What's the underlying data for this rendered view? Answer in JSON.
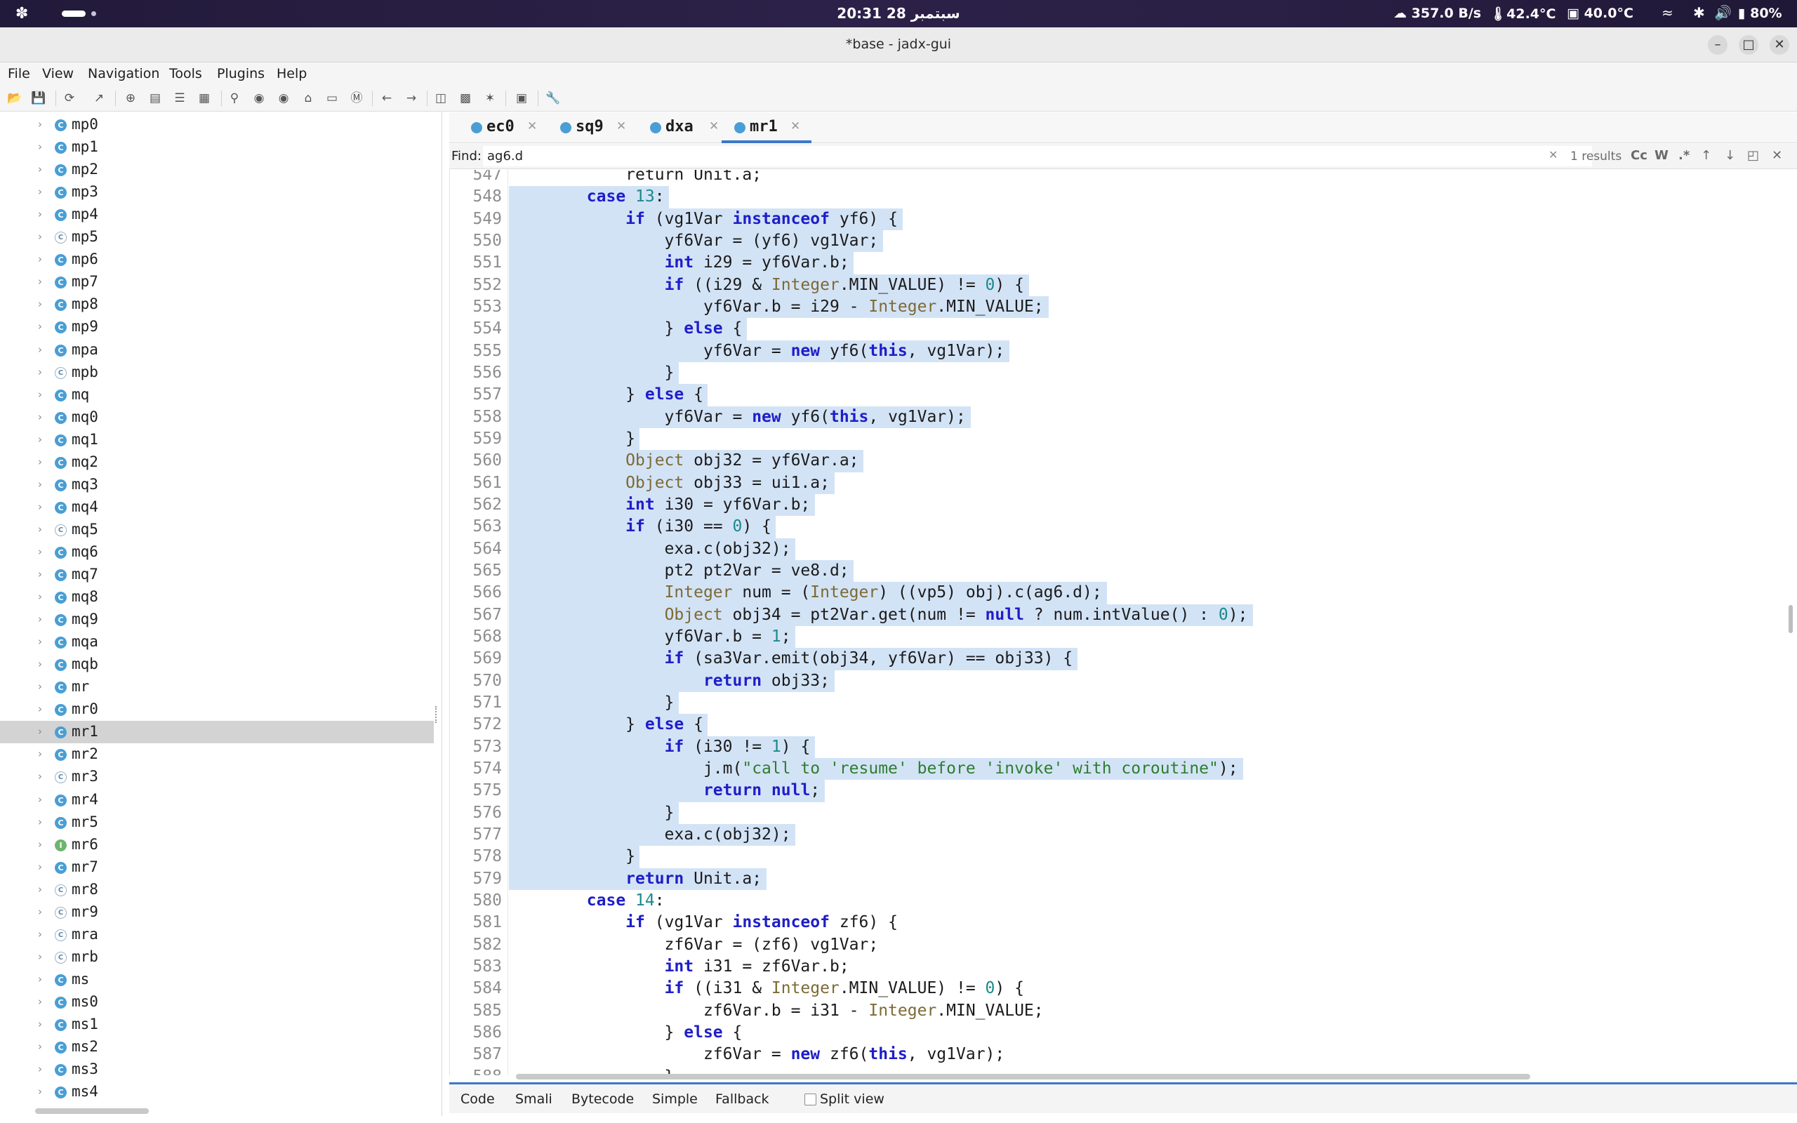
{
  "system_bar": {
    "clock": "20:31  28 سبتمبر",
    "net_speed": "357.0 B/s",
    "cpu_temp": "42.4°C",
    "gpu_temp": "40.0°C",
    "battery": "80%"
  },
  "window": {
    "title": "*base - jadx-gui"
  },
  "menu": [
    "File",
    "View",
    "Navigation",
    "Tools",
    "Plugins",
    "Help"
  ],
  "sidebar": {
    "items": [
      {
        "label": "mp0",
        "icon": "class"
      },
      {
        "label": "mp1",
        "icon": "class"
      },
      {
        "label": "mp2",
        "icon": "class"
      },
      {
        "label": "mp3",
        "icon": "class"
      },
      {
        "label": "mp4",
        "icon": "class"
      },
      {
        "label": "mp5",
        "icon": "plain"
      },
      {
        "label": "mp6",
        "icon": "class"
      },
      {
        "label": "mp7",
        "icon": "class"
      },
      {
        "label": "mp8",
        "icon": "class"
      },
      {
        "label": "mp9",
        "icon": "class"
      },
      {
        "label": "mpa",
        "icon": "class"
      },
      {
        "label": "mpb",
        "icon": "plain"
      },
      {
        "label": "mq",
        "icon": "class"
      },
      {
        "label": "mq0",
        "icon": "class"
      },
      {
        "label": "mq1",
        "icon": "class"
      },
      {
        "label": "mq2",
        "icon": "class"
      },
      {
        "label": "mq3",
        "icon": "class"
      },
      {
        "label": "mq4",
        "icon": "class"
      },
      {
        "label": "mq5",
        "icon": "plain"
      },
      {
        "label": "mq6",
        "icon": "class"
      },
      {
        "label": "mq7",
        "icon": "class"
      },
      {
        "label": "mq8",
        "icon": "class"
      },
      {
        "label": "mq9",
        "icon": "class"
      },
      {
        "label": "mqa",
        "icon": "class"
      },
      {
        "label": "mqb",
        "icon": "class"
      },
      {
        "label": "mr",
        "icon": "class"
      },
      {
        "label": "mr0",
        "icon": "class"
      },
      {
        "label": "mr1",
        "icon": "class",
        "selected": true
      },
      {
        "label": "mr2",
        "icon": "class"
      },
      {
        "label": "mr3",
        "icon": "plain"
      },
      {
        "label": "mr4",
        "icon": "class"
      },
      {
        "label": "mr5",
        "icon": "class"
      },
      {
        "label": "mr6",
        "icon": "interface"
      },
      {
        "label": "mr7",
        "icon": "class"
      },
      {
        "label": "mr8",
        "icon": "plain"
      },
      {
        "label": "mr9",
        "icon": "plain"
      },
      {
        "label": "mra",
        "icon": "plain"
      },
      {
        "label": "mrb",
        "icon": "plain"
      },
      {
        "label": "ms",
        "icon": "class"
      },
      {
        "label": "ms0",
        "icon": "class"
      },
      {
        "label": "ms1",
        "icon": "class"
      },
      {
        "label": "ms2",
        "icon": "class"
      },
      {
        "label": "ms3",
        "icon": "class"
      },
      {
        "label": "ms4",
        "icon": "class"
      }
    ]
  },
  "tabs": [
    {
      "label": "ec0"
    },
    {
      "label": "sq9"
    },
    {
      "label": "dxa"
    },
    {
      "label": "mr1",
      "active": true
    }
  ],
  "find": {
    "label": "Find:",
    "value": "ag6.d",
    "results": "1 results",
    "case_label": "Cc",
    "word_label": "W",
    "regex_label": ".*"
  },
  "code": {
    "lines": [
      {
        "n": "547",
        "hl": false,
        "t": [
          [
            "",
            "            return Unit.a;"
          ]
        ]
      },
      {
        "n": "548",
        "hl": true,
        "t": [
          [
            "",
            "        "
          ],
          [
            "kw",
            "case"
          ],
          [
            "",
            " "
          ],
          [
            "nm",
            "13"
          ],
          [
            "",
            ":"
          ]
        ]
      },
      {
        "n": "549",
        "hl": true,
        "t": [
          [
            "",
            "            "
          ],
          [
            "kw",
            "if"
          ],
          [
            "",
            " (vg1Var "
          ],
          [
            "kw",
            "instanceof"
          ],
          [
            "",
            " yf6) {"
          ]
        ]
      },
      {
        "n": "550",
        "hl": true,
        "t": [
          [
            "",
            "                yf6Var = (yf6) vg1Var;"
          ]
        ]
      },
      {
        "n": "551",
        "hl": true,
        "t": [
          [
            "",
            "                "
          ],
          [
            "kw",
            "int"
          ],
          [
            "",
            " i29 = yf6Var.b;"
          ]
        ]
      },
      {
        "n": "552",
        "hl": true,
        "t": [
          [
            "",
            "                "
          ],
          [
            "kw",
            "if"
          ],
          [
            "",
            " ((i29 & "
          ],
          [
            "ty",
            "Integer"
          ],
          [
            "",
            ".MIN_VALUE) != "
          ],
          [
            "nm",
            "0"
          ],
          [
            "",
            ") {"
          ]
        ]
      },
      {
        "n": "553",
        "hl": true,
        "t": [
          [
            "",
            "                    yf6Var.b = i29 - "
          ],
          [
            "ty",
            "Integer"
          ],
          [
            "",
            ".MIN_VALUE;"
          ]
        ]
      },
      {
        "n": "554",
        "hl": true,
        "t": [
          [
            "",
            "                } "
          ],
          [
            "kw",
            "else"
          ],
          [
            "",
            " {"
          ]
        ]
      },
      {
        "n": "555",
        "hl": true,
        "t": [
          [
            "",
            "                    yf6Var = "
          ],
          [
            "kw",
            "new"
          ],
          [
            "",
            " yf6("
          ],
          [
            "kw",
            "this"
          ],
          [
            "",
            ", vg1Var);"
          ]
        ]
      },
      {
        "n": "556",
        "hl": true,
        "t": [
          [
            "",
            "                }"
          ]
        ]
      },
      {
        "n": "557",
        "hl": true,
        "t": [
          [
            "",
            "            } "
          ],
          [
            "kw",
            "else"
          ],
          [
            "",
            " {"
          ]
        ]
      },
      {
        "n": "558",
        "hl": true,
        "t": [
          [
            "",
            "                yf6Var = "
          ],
          [
            "kw",
            "new"
          ],
          [
            "",
            " yf6("
          ],
          [
            "kw",
            "this"
          ],
          [
            "",
            ", vg1Var);"
          ]
        ]
      },
      {
        "n": "559",
        "hl": true,
        "t": [
          [
            "",
            "            }"
          ]
        ]
      },
      {
        "n": "560",
        "hl": true,
        "t": [
          [
            "",
            "            "
          ],
          [
            "ty",
            "Object"
          ],
          [
            "",
            " obj32 = yf6Var.a;"
          ]
        ]
      },
      {
        "n": "561",
        "hl": true,
        "t": [
          [
            "",
            "            "
          ],
          [
            "ty",
            "Object"
          ],
          [
            "",
            " obj33 = ui1.a;"
          ]
        ]
      },
      {
        "n": "562",
        "hl": true,
        "t": [
          [
            "",
            "            "
          ],
          [
            "kw",
            "int"
          ],
          [
            "",
            " i30 = yf6Var.b;"
          ]
        ]
      },
      {
        "n": "563",
        "hl": true,
        "t": [
          [
            "",
            "            "
          ],
          [
            "kw",
            "if"
          ],
          [
            "",
            " (i30 == "
          ],
          [
            "nm",
            "0"
          ],
          [
            "",
            ") {"
          ]
        ]
      },
      {
        "n": "564",
        "hl": true,
        "t": [
          [
            "",
            "                exa.c(obj32);"
          ]
        ]
      },
      {
        "n": "565",
        "hl": true,
        "t": [
          [
            "",
            "                pt2 pt2Var = ve8.d;"
          ]
        ]
      },
      {
        "n": "566",
        "hl": true,
        "t": [
          [
            "",
            "                "
          ],
          [
            "ty",
            "Integer"
          ],
          [
            "",
            " num = ("
          ],
          [
            "ty",
            "Integer"
          ],
          [
            "",
            ") ((vp5) obj).c(ag6.d);"
          ]
        ]
      },
      {
        "n": "567",
        "hl": true,
        "t": [
          [
            "",
            "                "
          ],
          [
            "ty",
            "Object"
          ],
          [
            "",
            " obj34 = pt2Var.get(num != "
          ],
          [
            "kw",
            "null"
          ],
          [
            "",
            " ? num.intValue() : "
          ],
          [
            "nm",
            "0"
          ],
          [
            "",
            ");"
          ]
        ]
      },
      {
        "n": "568",
        "hl": true,
        "t": [
          [
            "",
            "                yf6Var.b = "
          ],
          [
            "nm",
            "1"
          ],
          [
            "",
            ";"
          ]
        ]
      },
      {
        "n": "569",
        "hl": true,
        "t": [
          [
            "",
            "                "
          ],
          [
            "kw",
            "if"
          ],
          [
            "",
            " (sa3Var.emit(obj34, yf6Var) == obj33) {"
          ]
        ]
      },
      {
        "n": "570",
        "hl": true,
        "t": [
          [
            "",
            "                    "
          ],
          [
            "kw",
            "return"
          ],
          [
            "",
            " obj33;"
          ]
        ]
      },
      {
        "n": "571",
        "hl": true,
        "t": [
          [
            "",
            "                }"
          ]
        ]
      },
      {
        "n": "572",
        "hl": true,
        "t": [
          [
            "",
            "            } "
          ],
          [
            "kw",
            "else"
          ],
          [
            "",
            " {"
          ]
        ]
      },
      {
        "n": "573",
        "hl": true,
        "t": [
          [
            "",
            "                "
          ],
          [
            "kw",
            "if"
          ],
          [
            "",
            " (i30 != "
          ],
          [
            "nm",
            "1"
          ],
          [
            "",
            ") {"
          ]
        ]
      },
      {
        "n": "574",
        "hl": true,
        "t": [
          [
            "",
            "                    j.m("
          ],
          [
            "st",
            "\"call to 'resume' before 'invoke' with coroutine\""
          ],
          [
            "",
            ");"
          ]
        ]
      },
      {
        "n": "575",
        "hl": true,
        "t": [
          [
            "",
            "                    "
          ],
          [
            "kw",
            "return"
          ],
          [
            "",
            " "
          ],
          [
            "kw",
            "null"
          ],
          [
            "",
            ";"
          ]
        ]
      },
      {
        "n": "576",
        "hl": true,
        "t": [
          [
            "",
            "                }"
          ]
        ]
      },
      {
        "n": "577",
        "hl": true,
        "t": [
          [
            "",
            "                exa.c(obj32);"
          ]
        ]
      },
      {
        "n": "578",
        "hl": true,
        "t": [
          [
            "",
            "            }"
          ]
        ]
      },
      {
        "n": "579",
        "hl": true,
        "t": [
          [
            "",
            "            "
          ],
          [
            "kw",
            "return"
          ],
          [
            "",
            " Unit.a;"
          ]
        ]
      },
      {
        "n": "580",
        "hl": false,
        "t": [
          [
            "",
            "        "
          ],
          [
            "kw",
            "case"
          ],
          [
            "",
            " "
          ],
          [
            "nm",
            "14"
          ],
          [
            "",
            ":"
          ]
        ]
      },
      {
        "n": "581",
        "hl": false,
        "t": [
          [
            "",
            "            "
          ],
          [
            "kw",
            "if"
          ],
          [
            "",
            " (vg1Var "
          ],
          [
            "kw",
            "instanceof"
          ],
          [
            "",
            " zf6) {"
          ]
        ]
      },
      {
        "n": "582",
        "hl": false,
        "t": [
          [
            "",
            "                zf6Var = (zf6) vg1Var;"
          ]
        ]
      },
      {
        "n": "583",
        "hl": false,
        "t": [
          [
            "",
            "                "
          ],
          [
            "kw",
            "int"
          ],
          [
            "",
            " i31 = zf6Var.b;"
          ]
        ]
      },
      {
        "n": "584",
        "hl": false,
        "t": [
          [
            "",
            "                "
          ],
          [
            "kw",
            "if"
          ],
          [
            "",
            " ((i31 & "
          ],
          [
            "ty",
            "Integer"
          ],
          [
            "",
            ".MIN_VALUE) != "
          ],
          [
            "nm",
            "0"
          ],
          [
            "",
            ") {"
          ]
        ]
      },
      {
        "n": "585",
        "hl": false,
        "t": [
          [
            "",
            "                    zf6Var.b = i31 - "
          ],
          [
            "ty",
            "Integer"
          ],
          [
            "",
            ".MIN_VALUE;"
          ]
        ]
      },
      {
        "n": "586",
        "hl": false,
        "t": [
          [
            "",
            "                } "
          ],
          [
            "kw",
            "else"
          ],
          [
            "",
            " {"
          ]
        ]
      },
      {
        "n": "587",
        "hl": false,
        "t": [
          [
            "",
            "                    zf6Var = "
          ],
          [
            "kw",
            "new"
          ],
          [
            "",
            " zf6("
          ],
          [
            "kw",
            "this"
          ],
          [
            "",
            ", vg1Var);"
          ]
        ]
      },
      {
        "n": "588",
        "hl": false,
        "t": [
          [
            "",
            "                }"
          ]
        ]
      }
    ]
  },
  "bottom_tabs": [
    "Code",
    "Smali",
    "Bytecode",
    "Simple",
    "Fallback"
  ],
  "split_view_label": "Split view",
  "colors": {
    "selection": "#d3e3f6",
    "keyword": "#1e1ec8",
    "active_tab": "#3b78c9"
  }
}
